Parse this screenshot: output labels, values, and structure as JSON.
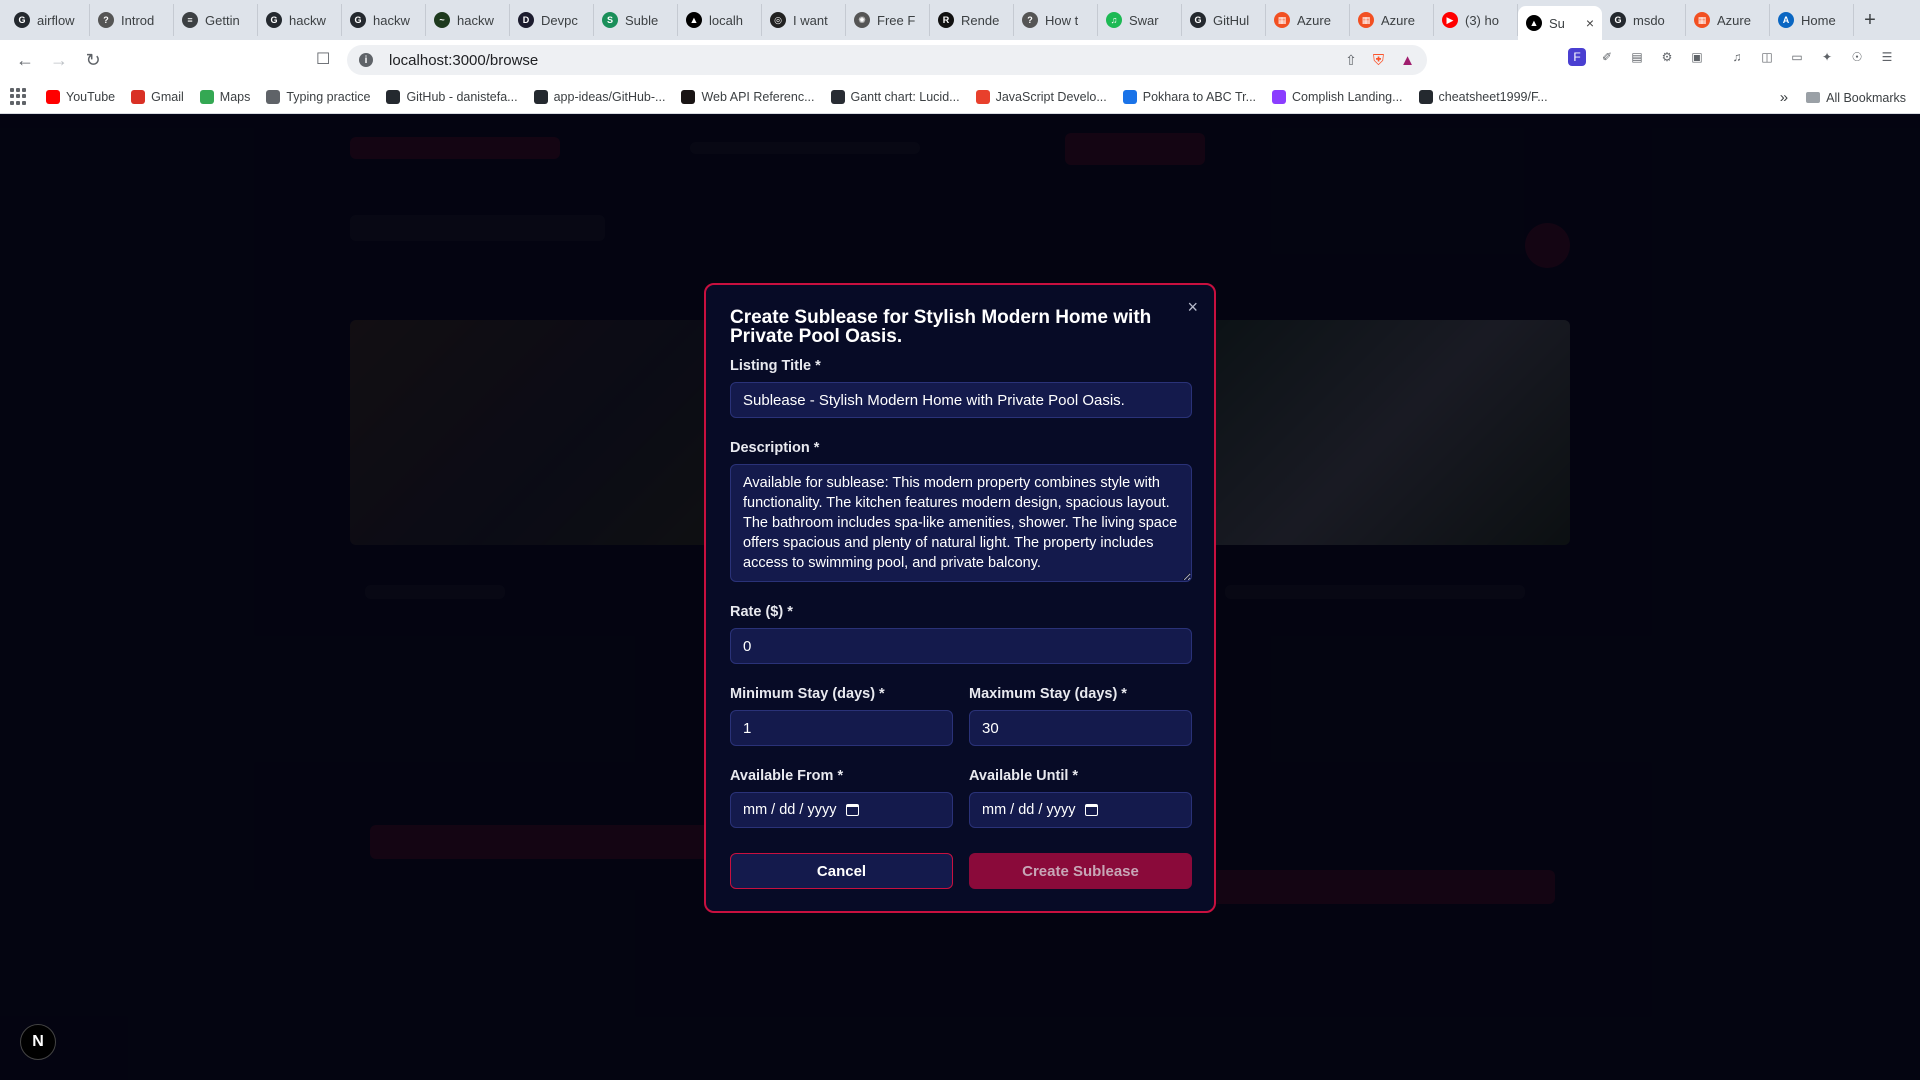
{
  "browser": {
    "tabs": [
      {
        "label": "airflow",
        "color": "#24292f",
        "glyph": "G"
      },
      {
        "label": "Introd",
        "color": "#555555",
        "glyph": "?"
      },
      {
        "label": "Gettin",
        "color": "#3c4043",
        "glyph": "≡"
      },
      {
        "label": "hackw",
        "color": "#24292f",
        "glyph": "G"
      },
      {
        "label": "hackw",
        "color": "#24292f",
        "glyph": "G"
      },
      {
        "label": "hackw",
        "color": "#1e3a1e",
        "glyph": "~"
      },
      {
        "label": "Devpc",
        "color": "#1c1c2e",
        "glyph": "D"
      },
      {
        "label": "Suble",
        "color": "#1a8f5a",
        "glyph": "S"
      },
      {
        "label": "localh",
        "color": "#000000",
        "glyph": "▲"
      },
      {
        "label": "I want",
        "color": "#222222",
        "glyph": "◎"
      },
      {
        "label": "Free F",
        "color": "#555555",
        "glyph": "✺"
      },
      {
        "label": "Rende",
        "color": "#111111",
        "glyph": "R"
      },
      {
        "label": "How t",
        "color": "#555555",
        "glyph": "?"
      },
      {
        "label": "Swar",
        "color": "#1db954",
        "glyph": "♫"
      },
      {
        "label": "GitHul",
        "color": "#24292f",
        "glyph": "G"
      },
      {
        "label": "Azure",
        "color": "#f25022",
        "glyph": "▦"
      },
      {
        "label": "Azure",
        "color": "#f25022",
        "glyph": "▦"
      },
      {
        "label": "(3) ho",
        "color": "#ff0000",
        "glyph": "▶"
      },
      {
        "label": "Su",
        "color": "#000000",
        "glyph": "▲",
        "active": true
      },
      {
        "label": "msdo",
        "color": "#24292f",
        "glyph": "G"
      },
      {
        "label": "Azure",
        "color": "#f25022",
        "glyph": "▦"
      },
      {
        "label": "Home",
        "color": "#0a66c2",
        "glyph": "A"
      }
    ],
    "new_tab": "+",
    "url": "localhost:3000/browse",
    "bookmarks": [
      {
        "label": "YouTube",
        "color": "#ff0000"
      },
      {
        "label": "Gmail",
        "color": "#d93025"
      },
      {
        "label": "Maps",
        "color": "#34a853"
      },
      {
        "label": "Typing practice",
        "color": "#5f6368"
      },
      {
        "label": "GitHub - danistefa...",
        "color": "#24292f"
      },
      {
        "label": "app-ideas/GitHub-...",
        "color": "#24292f"
      },
      {
        "label": "Web API Referenc...",
        "color": "#191414"
      },
      {
        "label": "Gantt chart: Lucid...",
        "color": "#282c33"
      },
      {
        "label": "JavaScript Develo...",
        "color": "#e8402c"
      },
      {
        "label": "Pokhara to ABC Tr...",
        "color": "#1a73e8"
      },
      {
        "label": "Complish Landing...",
        "color": "#8b3dff"
      },
      {
        "label": "cheatsheet1999/F...",
        "color": "#24292f"
      }
    ],
    "bookmarks_overflow": "»",
    "all_bookmarks": "All Bookmarks"
  },
  "modal": {
    "title": "Create Sublease for Stylish Modern Home with Private Pool Oasis.",
    "close": "×",
    "listing_title": {
      "label": "Listing Title *",
      "value": "Sublease - Stylish Modern Home with Private Pool Oasis."
    },
    "description": {
      "label": "Description *",
      "value": "Available for sublease: This modern property combines style with functionality. The kitchen features modern design, spacious layout. The bathroom includes spa-like amenities, shower. The living space offers spacious and plenty of natural light. The property includes access to swimming pool, and private balcony."
    },
    "rate": {
      "label": "Rate ($) *",
      "value": "0"
    },
    "min_stay": {
      "label": "Minimum Stay (days) *",
      "value": "1"
    },
    "max_stay": {
      "label": "Maximum Stay (days) *",
      "value": "30"
    },
    "available_from": {
      "label": "Available From *",
      "placeholder": "mm / dd / yyyy"
    },
    "available_until": {
      "label": "Available Until *",
      "placeholder": "mm / dd / yyyy"
    },
    "cancel_label": "Cancel",
    "create_label": "Create Sublease"
  },
  "dev_badge": "N"
}
